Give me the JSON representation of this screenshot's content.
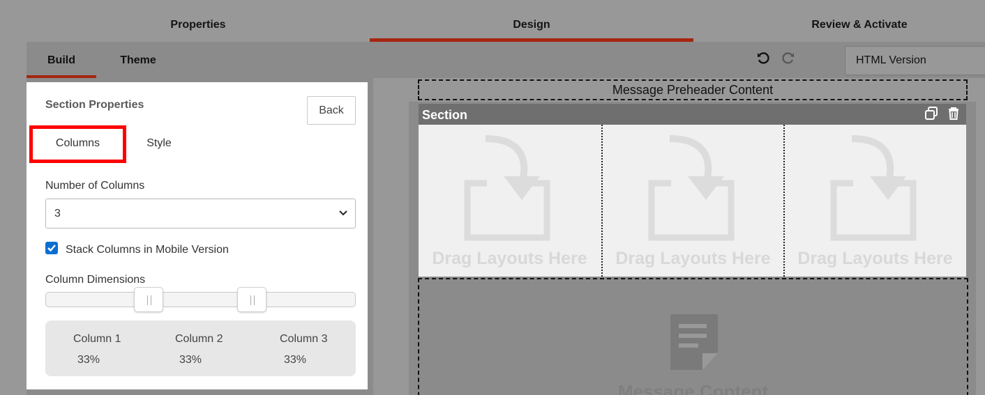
{
  "steps": [
    {
      "label": "Properties",
      "active": false
    },
    {
      "label": "Design",
      "active": true
    },
    {
      "label": "Review & Activate",
      "active": false
    }
  ],
  "subtabs": [
    {
      "label": "Build",
      "active": true
    },
    {
      "label": "Theme",
      "active": false
    }
  ],
  "toolbar": {
    "undo_icon": "undo-icon",
    "redo_icon": "redo-icon",
    "version_value": "HTML Version"
  },
  "panel": {
    "title": "Section Properties",
    "back_label": "Back",
    "tabs": [
      {
        "label": "Columns",
        "active": true,
        "highlighted": true
      },
      {
        "label": "Style",
        "active": false
      }
    ],
    "num_columns_label": "Number of Columns",
    "num_columns_value": "3",
    "stack_label": "Stack Columns in Mobile Version",
    "stack_checked": true,
    "dimensions_label": "Column Dimensions",
    "columns": [
      {
        "name": "Column 1",
        "width": "33%"
      },
      {
        "name": "Column 2",
        "width": "33%"
      },
      {
        "name": "Column 3",
        "width": "33%"
      }
    ]
  },
  "canvas": {
    "preheader_text": "Message Preheader Content",
    "section_title": "Section",
    "drop_label": "Drag Layouts Here",
    "message_label": "Message Content"
  },
  "colors": {
    "accent": "#a6250f",
    "highlight": "#ff0000",
    "checkbox": "#0a6ed1"
  }
}
